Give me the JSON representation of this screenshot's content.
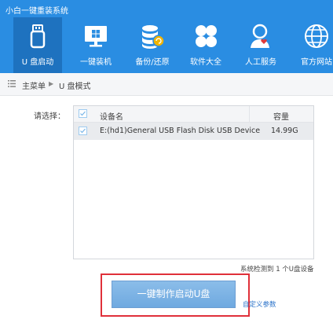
{
  "app": {
    "title": "小白一键重装系统"
  },
  "nav": [
    {
      "label": "U 盘启动",
      "icon": "usb-drive-icon",
      "active": true
    },
    {
      "label": "一键装机",
      "icon": "windows-monitor-icon",
      "active": false
    },
    {
      "label": "备份/还原",
      "icon": "database-backup-icon",
      "active": false
    },
    {
      "label": "软件大全",
      "icon": "apps-grid-icon",
      "active": false
    },
    {
      "label": "人工服务",
      "icon": "support-person-icon",
      "active": false
    },
    {
      "label": "官方网站",
      "icon": "globe-icon",
      "active": false
    }
  ],
  "breadcrumb": {
    "home": "主菜单",
    "current": "U 盘模式"
  },
  "select_label": "请选择：",
  "table": {
    "columns": {
      "name": "设备名",
      "capacity": "容量"
    },
    "rows": [
      {
        "name": "E:(hd1)General USB Flash Disk USB Device",
        "capacity": "14.99G",
        "checked": true
      }
    ]
  },
  "status": {
    "detected": "系统检测到 1 个U盘设备"
  },
  "actions": {
    "make_boot": "一键制作启动U盘",
    "custom_params": "自定义参数"
  },
  "colors": {
    "header": "#2a8de2",
    "header_active": "#1e72bf",
    "highlight_border": "#e0303a",
    "button": "#7fb3e5"
  }
}
